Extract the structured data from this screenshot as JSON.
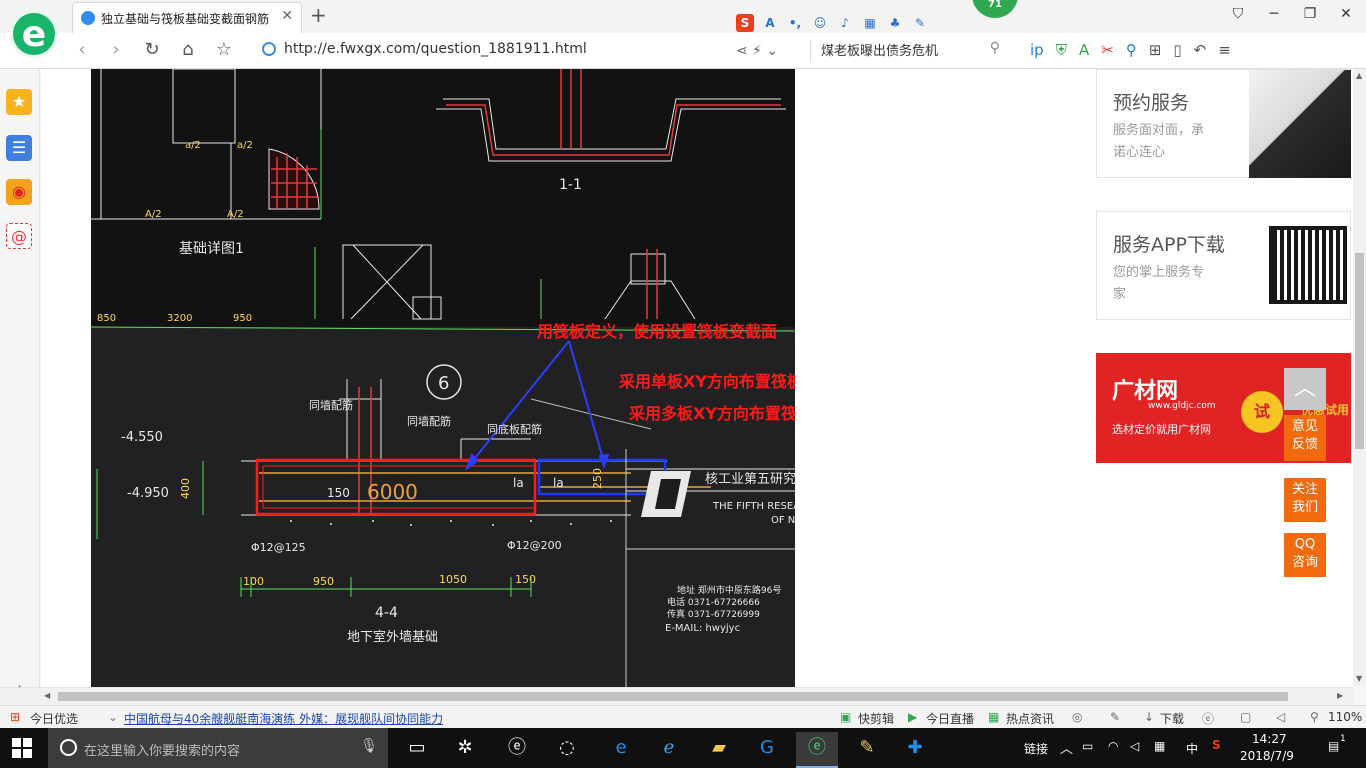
{
  "browser": {
    "tab_title": "独立基础与筏板基础变截面钢筋",
    "url": "http://e.fwxgx.com/question_1881911.html",
    "search_text": "煤老板曝出债务危机",
    "badge_number": "71"
  },
  "drawing": {
    "annotation_1": "用筏板定义，使用设置筏板变截面",
    "annotation_2": "采用单板XY方向布置筏板底筋，",
    "annotation_3": "采用多板XY方向布置筏板板面钢筋",
    "cad_labels": {
      "detail_title": "基础详图1",
      "section_11": "1-1",
      "section_44": "4-4",
      "basement_label": "地下室外墙基础",
      "elev_1": "-4.550",
      "elev_2": "-4.950",
      "dim_400": "400",
      "dim_150": "150",
      "dim_6000": "6000",
      "dim_250": "250",
      "la_1": "la",
      "la_2": "la",
      "rebar_1": "Φ12@125",
      "rebar_2": "Φ12@200",
      "dim_100": "100",
      "dim_950": "950",
      "dim_1050": "1050",
      "dim_150b": "150",
      "circle_6": "6",
      "wall_rebar_1": "同墙配筋",
      "wall_rebar_2": "同墙配筋",
      "wall_rebar_3": "同底板配筋",
      "title_block_1": "核工业第五研究",
      "title_block_2": "THE FIFTH RESEA",
      "title_block_3": "OF N",
      "email": "E-MAIL: hwyjyc",
      "phone_1": "电话 0371-67726666",
      "phone_2": "传真 0371-67726999",
      "address": "地址  郑州市中原东路96号",
      "top_dims": [
        "A/2",
        "A/2",
        "a/2",
        "a/2",
        "850",
        "3200",
        "950"
      ]
    }
  },
  "sidebar_ads": {
    "box1_title": "预约服务",
    "box1_sub_line1": "服务面对面，承",
    "box1_sub_line2": "诺心连心",
    "box2_title": "服务APP下载",
    "box2_sub_line1": "您的掌上服务专",
    "box2_sub_line2": "家",
    "banner_logo": "广材网",
    "banner_url": "www.gldjc.com",
    "banner_slogan": "选材定价就用广材网",
    "banner_try": "试",
    "banner_right": "优惠试用",
    "float_feedback": "意见\n反馈",
    "float_follow": "关注\n我们",
    "float_qq": "QQ\n咨询"
  },
  "statusbar": {
    "left_label": "今日优选",
    "news": "中国航母与40余艘舰艇南海演练 外媒：展现舰队间协同能力",
    "quick_cut": "快剪辑",
    "live": "今日直播",
    "hot": "热点资讯",
    "download": "下载",
    "zoom": "110%"
  },
  "taskbar": {
    "search_placeholder": "在这里输入你要搜索的内容",
    "tray_link": "链接",
    "ime": "中",
    "time": "14:27",
    "date": "2018/7/9",
    "notif": "1"
  }
}
